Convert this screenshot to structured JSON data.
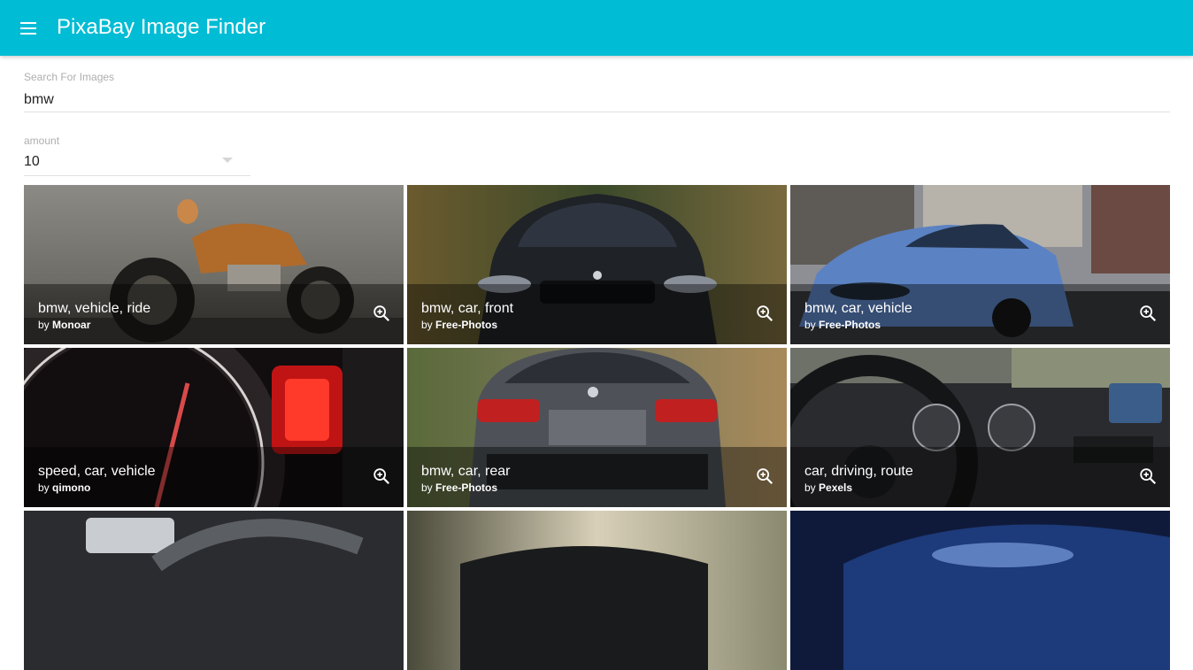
{
  "app": {
    "title": "PixaBay Image Finder",
    "accent_color": "#00bcd4",
    "menu_icon": "menu-icon"
  },
  "search": {
    "label": "Search For Images",
    "value": "bmw"
  },
  "amount": {
    "label": "amount",
    "value": "10"
  },
  "tiles": [
    {
      "title": "bmw, vehicle, ride",
      "by_prefix": "by",
      "author": "Monoar"
    },
    {
      "title": "bmw, car, front",
      "by_prefix": "by",
      "author": "Free-Photos"
    },
    {
      "title": "bmw, car, vehicle",
      "by_prefix": "by",
      "author": "Free-Photos"
    },
    {
      "title": "speed, car, vehicle",
      "by_prefix": "by",
      "author": "qimono"
    },
    {
      "title": "bmw, car, rear",
      "by_prefix": "by",
      "author": "Free-Photos"
    },
    {
      "title": "car, driving, route",
      "by_prefix": "by",
      "author": "Pexels"
    }
  ]
}
